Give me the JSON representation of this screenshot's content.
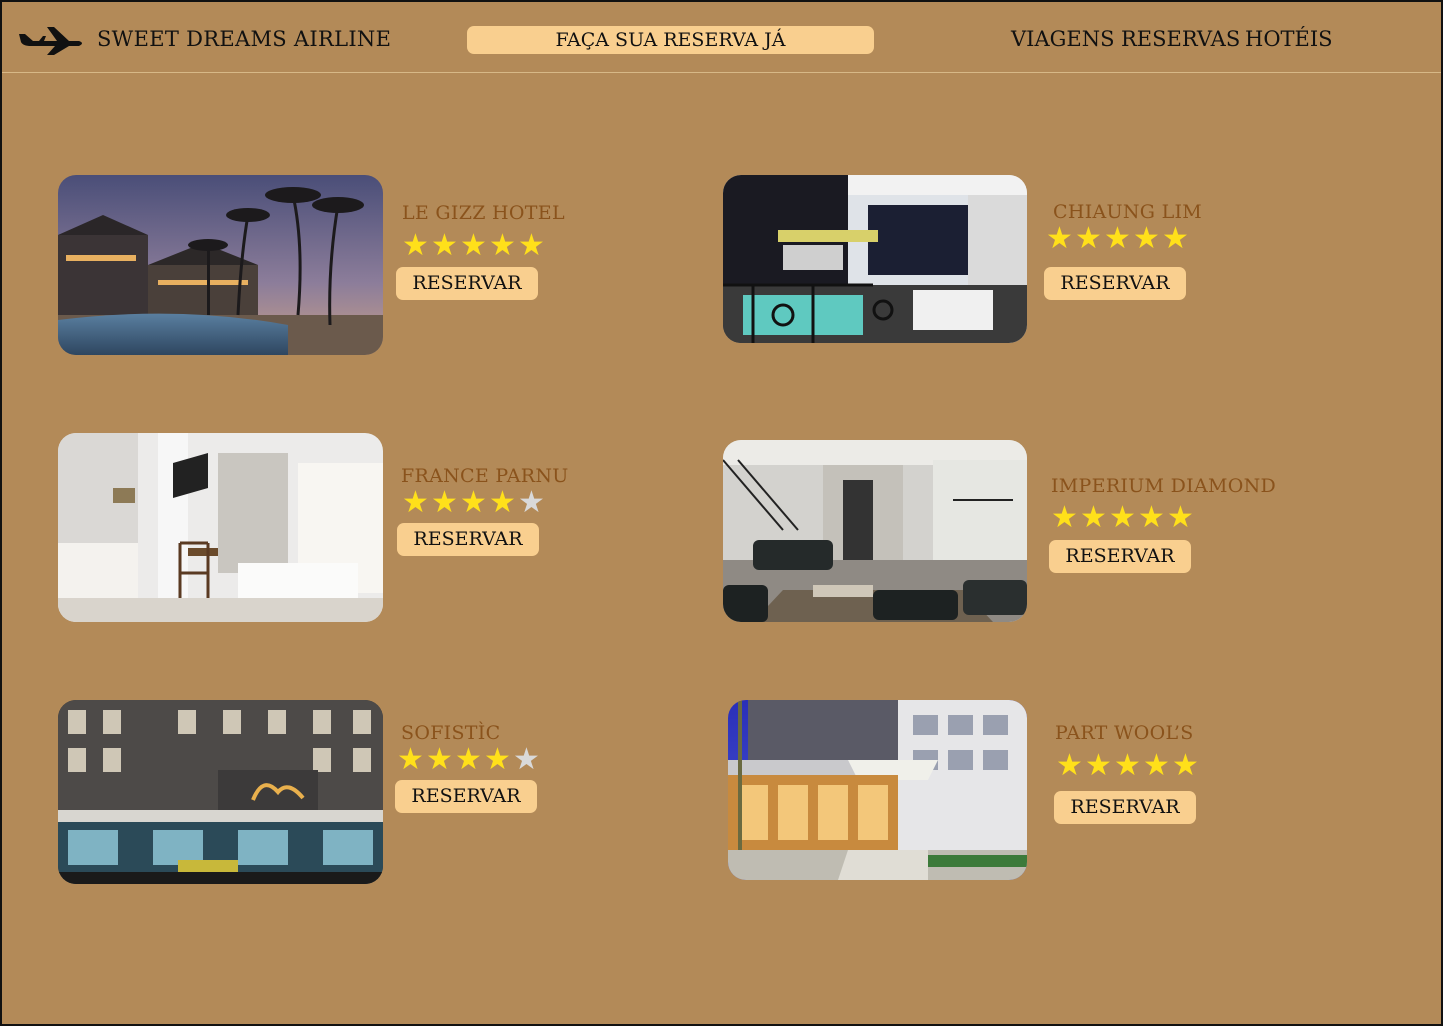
{
  "header": {
    "brand": "SWEET DREAMS AIRLINE",
    "cta": "FAÇA SUA RESERVA JÁ",
    "nav": [
      "VIAGENS",
      "RESERVAS",
      "HOTÉIS"
    ]
  },
  "colors": {
    "background": "#b38a58",
    "button": "#f9cf8f",
    "hotel_name": "#8a531c",
    "star_on": "#ffe01a",
    "star_off": "#d9d9d9"
  },
  "hotels": [
    {
      "name": "LE GIZZ HOTEL",
      "rating": 5,
      "button": "RESERVAR",
      "image": "resort-pool-palms-night"
    },
    {
      "name": "CHIAUNG LIM",
      "rating": 5,
      "button": "RESERVAR",
      "image": "hotel-bar-dining"
    },
    {
      "name": "FRANCE PARNU",
      "rating": 4,
      "button": "RESERVAR",
      "image": "hotel-bedroom"
    },
    {
      "name": "IMPERIUM DIAMOND",
      "rating": 5,
      "button": "RESERVAR",
      "image": "hotel-lobby-sofas"
    },
    {
      "name": "SOFISTÌC",
      "rating": 4,
      "button": "RESERVAR",
      "image": "hotel-facade-night"
    },
    {
      "name": "PART WOOL’S",
      "rating": 5,
      "button": "RESERVAR",
      "image": "hotel-entrance-dusk"
    }
  ]
}
